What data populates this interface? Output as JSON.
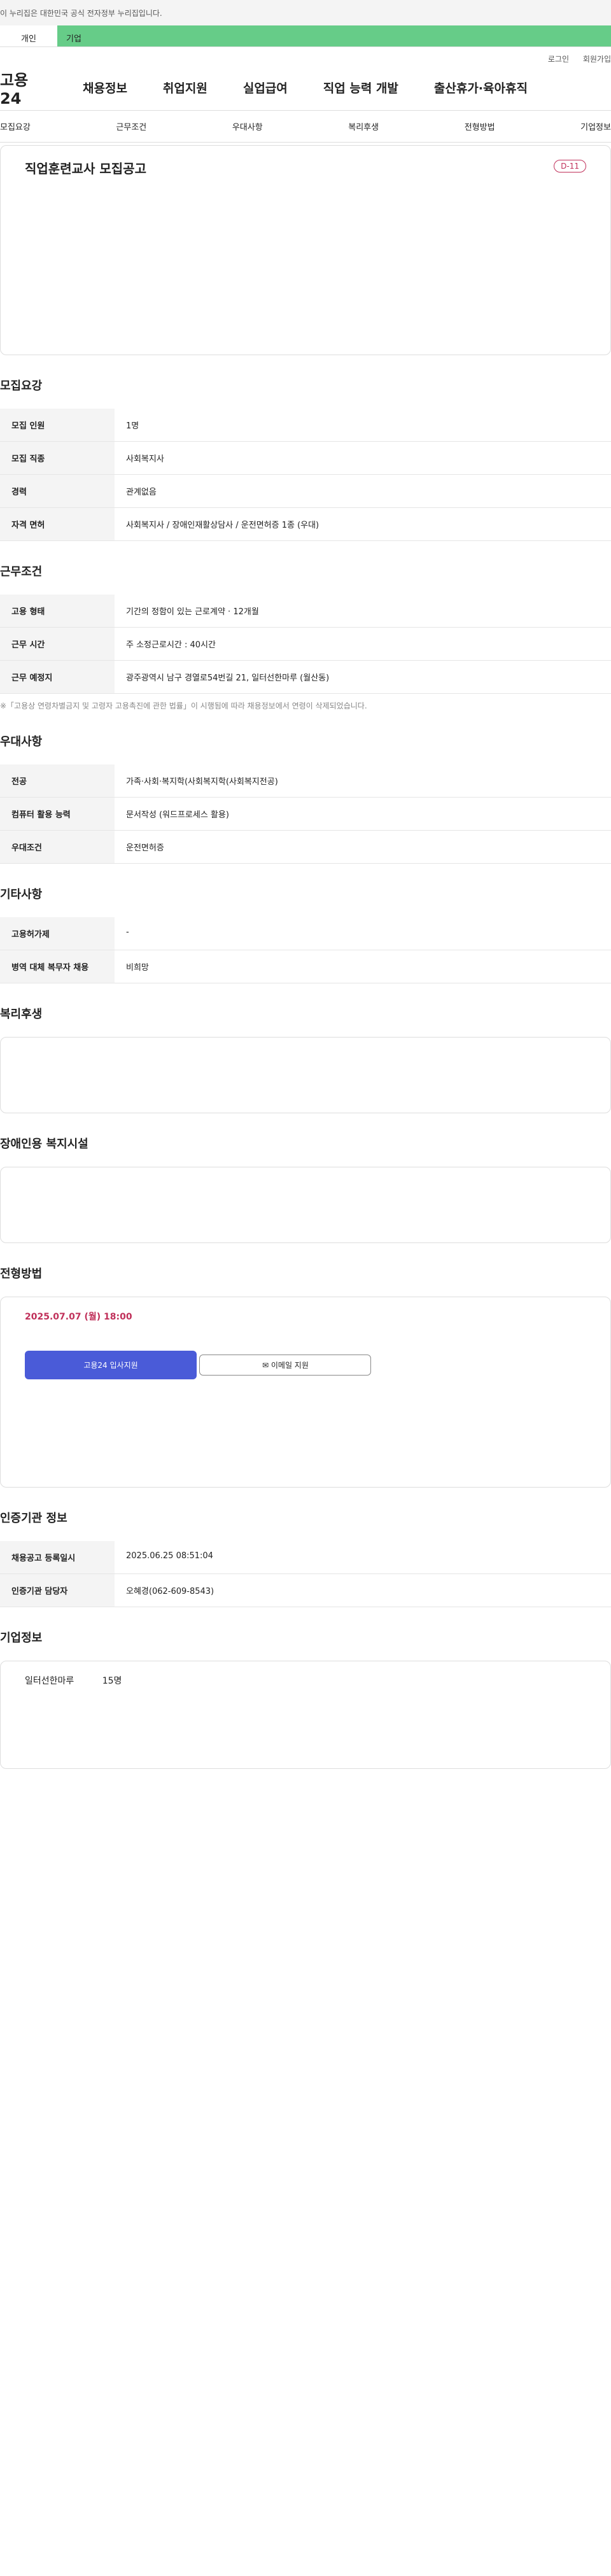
{
  "banner": "이 누리집은 대한민국 공식 전자정부 누리집입니다.",
  "tabs": [
    "개인",
    "기업"
  ],
  "util": [
    "로그인",
    "회원가입"
  ],
  "logo": "고용24",
  "gnb": [
    "채용정보",
    "취업지원",
    "실업급여",
    "직업 능력 개발",
    "출산휴가·육아휴직"
  ],
  "snb": [
    "모집요강",
    "근무조건",
    "우대사항",
    "복리후생",
    "전형방법",
    "기업정보"
  ],
  "job": {
    "title": "직업훈련교사 모집공고",
    "dday": "D-11"
  },
  "sec": [
    "모집요강",
    "근무조건",
    "우대사항",
    "기타사항",
    "복리후생",
    "장애인용 복지시설",
    "전형방법",
    "인증기관 정보",
    "기업정보"
  ],
  "s1": [
    [
      "모집 인원",
      "1명"
    ],
    [
      "모집 직종",
      "사회복지사"
    ],
    [
      "경력",
      "관계없음"
    ],
    [
      "자격 면허",
      "사회복지사 / 장애인재활상담사 / 운전면허증 1종 (우대)"
    ]
  ],
  "s2": [
    [
      "고용 형태",
      "기간의 정함이 있는 근로계약 · 12개월"
    ],
    [
      "근무 시간",
      "주 소정근로시간 : 40시간"
    ],
    [
      "근무 예정지",
      "광주광역시 남구 경열로54번길 21, 일터선한마루 (월산동)"
    ]
  ],
  "notice": "※「고용상 연령차별금지 및 고령자 고용촉진에 관한 법률」이 시행됨에 따라 채용정보에서 연령이 삭제되었습니다.",
  "s3": [
    [
      "전공",
      "가족·사회·복지학(사회복지학(사회복지전공)"
    ],
    [
      "컴퓨터 활용 능력",
      "문서작성 (워드프로세스 활용)"
    ],
    [
      "우대조건",
      "운전면허증"
    ]
  ],
  "s4": [
    [
      "고용허가제",
      "-"
    ],
    [
      "병역 대체 복무자 채용",
      "비희망"
    ]
  ],
  "deadline": "2025.07.07 (월) 18:00",
  "apply": {
    "primary": "고용24 입사지원",
    "email": "이메일 지원"
  },
  "s5": [
    [
      "채용공고 등록일시",
      "2025.06.25 08:51:04"
    ],
    [
      "인증기관 담당자",
      "오혜경(062-609-8543)"
    ]
  ],
  "company": {
    "name": "일터선한마루",
    "size": "15명"
  }
}
